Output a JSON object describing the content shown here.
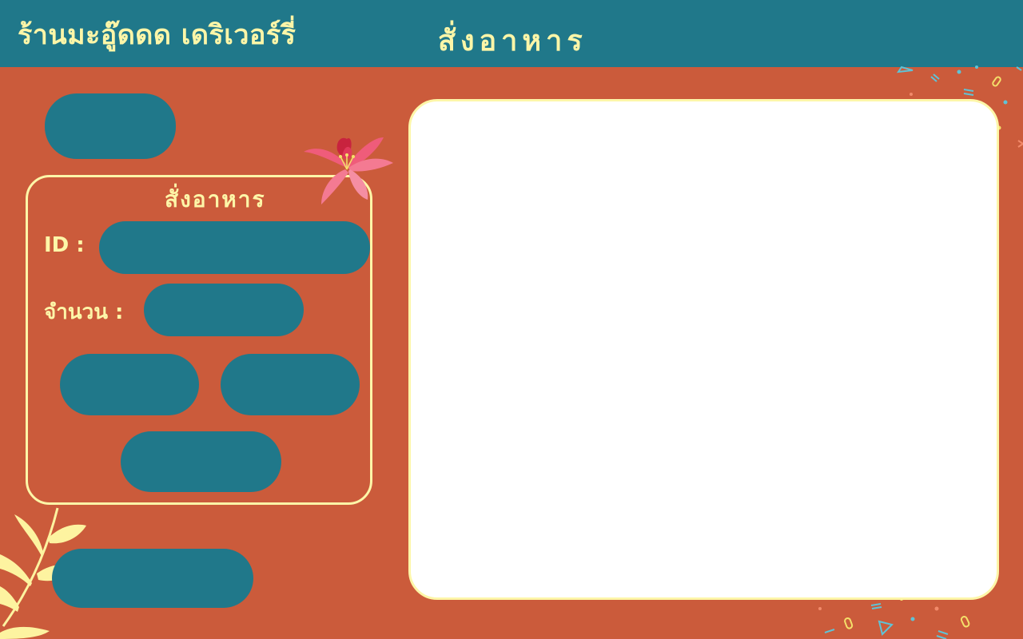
{
  "header": {
    "shop_name": "ร้านมะอู๊ดดด เดริเวอร์รี่",
    "page_title": "สั่งอาหาร"
  },
  "order_form": {
    "title": "สั่งอาหาร",
    "id_label": "ID :",
    "id_value": "",
    "quantity_label": "จำนวน :",
    "quantity_value": ""
  },
  "buttons": {
    "top_button_label": "",
    "action_left_label": "",
    "action_right_label": "",
    "action_center_label": "",
    "bottom_button_label": ""
  },
  "colors": {
    "background": "#cb5b3b",
    "header_bar": "#20788a",
    "button_fill": "#20788a",
    "accent_text": "#fdf6a8",
    "panel_border": "#fdf6a8",
    "result_area": "#ffffff"
  },
  "decorations": {
    "flower": "pink-lily-flower-icon",
    "leaves": "yellow-leaf-branch-icon",
    "confetti": "confetti-decoration"
  }
}
